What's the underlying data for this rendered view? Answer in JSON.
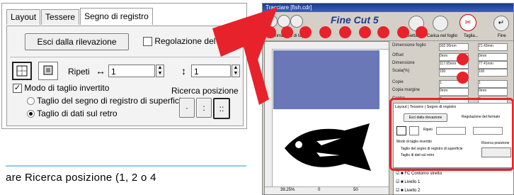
{
  "panel": {
    "tabs": [
      "Layout",
      "Tessere",
      "Segno di registro"
    ],
    "exit_button": "Esci dalla rilevazione",
    "format_checkbox": "Regolazione del formato",
    "repeat_label": "Ripeti",
    "h_arrow": "↔",
    "v_arrow": "↕",
    "repeat_h_value": "1",
    "repeat_v_value": "1",
    "inverted_mode": "Modo di taglio invertito",
    "search_position": "Ricerca posizione",
    "radio_surface": "Taglio del segno di registro di superficie",
    "radio_back": "Taglio di dati sul retro"
  },
  "window": {
    "title": "Tracciare [fish.cdr]",
    "logo": "Fine Cut 5",
    "toolbar_labels": [
      "Anteprima",
      "Scala di taglio",
      "Proietta",
      "Carica nel foglio",
      "Taglia...",
      "Fine"
    ],
    "rows": [
      {
        "label": "Dimensione foglio",
        "a": "302.00mm",
        "b": "21.43mm"
      },
      {
        "label": "Offset",
        "a": "0mm",
        "b": "0mm"
      },
      {
        "label": "Dimensione",
        "a": "117.65mm",
        "b": "77.41mm"
      },
      {
        "label": "Scala(%)",
        "a": "100",
        "b": "100"
      },
      {
        "label": "Copie",
        "a": "1",
        "b": "1"
      },
      {
        "label": "Copia margine",
        "a": "0mm",
        "b": "0mm"
      },
      {
        "label": "Centro",
        "a": "0mm",
        "b": "0mm"
      }
    ],
    "small_tabs": [
      "Layout",
      "Tessere",
      "Segno di registro"
    ],
    "small_exit": "Esci dalla rilevazione",
    "small_format": "Regolazione del formato",
    "small_repeat": "Ripeti",
    "small_mode": "Modo di taglio invertito",
    "small_search": "Ricerca posizione",
    "small_r1": "Taglio del segno di registro di superficie",
    "small_r2": "Taglio di dati sul retro",
    "layers": [
      "FC Contorno stretto",
      "Livello 1",
      "Livello 2"
    ],
    "zoom": "39.25%",
    "ruler_marks": [
      "0",
      "50"
    ]
  },
  "caption": "are Ricerca posizione (1, 2 o 4",
  "colors": {
    "accent_red": "#e8222a",
    "rule_blue": "#8fc7ee",
    "canvas_blue": "#6b78b8"
  }
}
